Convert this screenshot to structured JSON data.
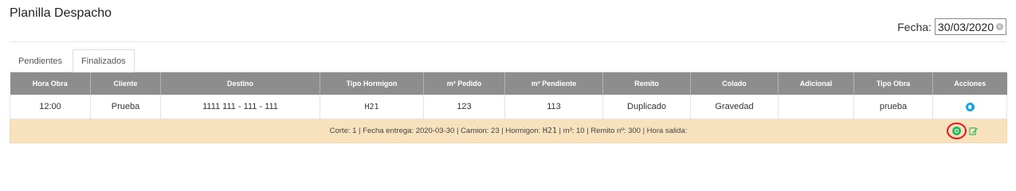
{
  "page": {
    "title": "Planilla Despacho"
  },
  "date_filter": {
    "label": "Fecha:",
    "value": "30/03/2020"
  },
  "tabs": [
    {
      "label": "Pendientes",
      "active": false
    },
    {
      "label": "Finalizados",
      "active": true
    }
  ],
  "table": {
    "headers": [
      "Hora Obra",
      "Cliente",
      "Destino",
      "Tipo Hormigon",
      "m³ Pedido",
      "m³ Pendiente",
      "Remito",
      "Colado",
      "Adicional",
      "Tipo Obra",
      "Acciones"
    ],
    "row": {
      "hora_obra": "12:00",
      "cliente": "Prueba",
      "destino": "1111 111 - 111 - 111",
      "tipo_hormigon": "H21",
      "m3_pedido": "123",
      "m3_pendiente": "113",
      "remito": "Duplicado",
      "colado": "Gravedad",
      "adicional": "",
      "tipo_obra": "prueba",
      "action_icon": "refresh-circle-icon"
    },
    "detail": {
      "text_before": "Corte: 1 | Fecha entrega: 2020-03-30 | Camion: 23 | Hormigon: ",
      "hormigon": "H21",
      "text_after": " | m³: 10 | Remito nº: 300 | Hora salida:",
      "icons": [
        "eye-icon",
        "edit-icon"
      ]
    }
  },
  "colors": {
    "header_bg": "#8d8d8d",
    "detail_bg": "#f8e2bd",
    "action_blue": "#1aa3e8",
    "view_green": "#2eb85c",
    "highlight_red": "#e8141a"
  }
}
